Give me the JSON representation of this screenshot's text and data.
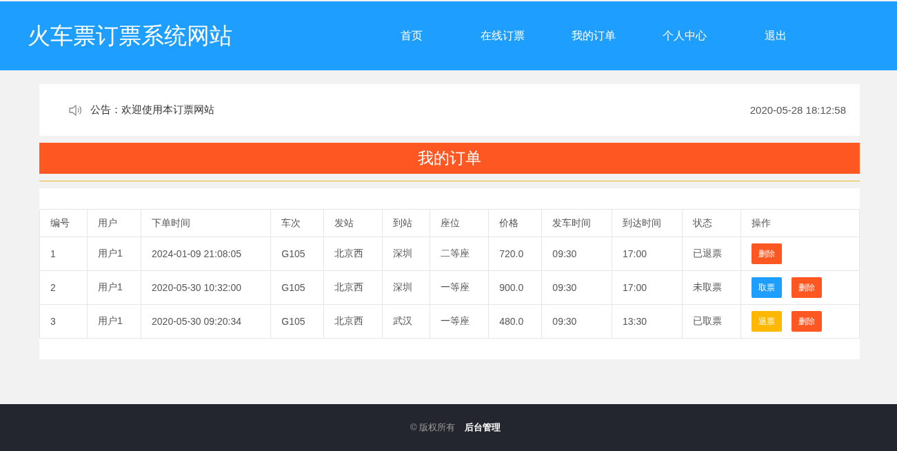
{
  "header": {
    "title": "火车票订票系统网站",
    "nav": [
      {
        "label": "首页"
      },
      {
        "label": "在线订票"
      },
      {
        "label": "我的订单"
      },
      {
        "label": "个人中心"
      },
      {
        "label": "退出"
      }
    ]
  },
  "notice": {
    "label": "公告：",
    "text": "欢迎使用本订票网站",
    "datetime": "2020-05-28 18:12:58"
  },
  "section_title": "我的订单",
  "table": {
    "columns": [
      "编号",
      "用户",
      "下单时间",
      "车次",
      "发站",
      "到站",
      "座位",
      "价格",
      "发车时间",
      "到达时间",
      "状态",
      "操作"
    ],
    "rows": [
      {
        "cells": [
          "1",
          "用户1",
          "2024-01-09 21:08:05",
          "G105",
          "北京西",
          "深圳",
          "二等座",
          "720.0",
          "09:30",
          "17:00",
          "已退票"
        ],
        "actions": [
          {
            "label": "删除",
            "kind": "delete"
          }
        ]
      },
      {
        "cells": [
          "2",
          "用户1",
          "2020-05-30 10:32:00",
          "G105",
          "北京西",
          "深圳",
          "一等座",
          "900.0",
          "09:30",
          "17:00",
          "未取票"
        ],
        "actions": [
          {
            "label": "取票",
            "kind": "take"
          },
          {
            "label": "删除",
            "kind": "delete"
          }
        ]
      },
      {
        "cells": [
          "3",
          "用户1",
          "2020-05-30 09:20:34",
          "G105",
          "北京西",
          "武汉",
          "一等座",
          "480.0",
          "09:30",
          "13:30",
          "已取票"
        ],
        "actions": [
          {
            "label": "退票",
            "kind": "refund"
          },
          {
            "label": "删除",
            "kind": "delete"
          }
        ]
      }
    ]
  },
  "footer": {
    "copyright": "© 版权所有",
    "admin_link": "后台管理"
  }
}
